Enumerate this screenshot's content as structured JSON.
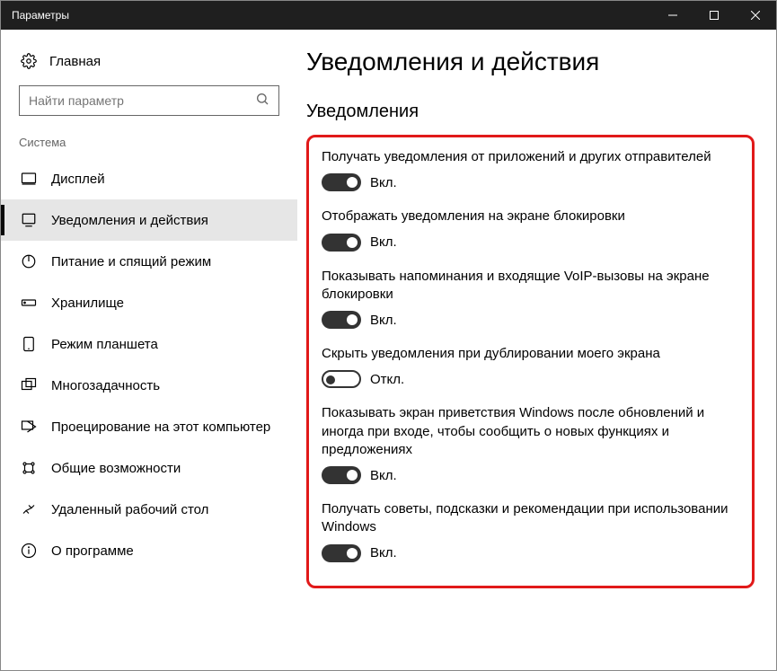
{
  "window": {
    "title": "Параметры"
  },
  "sidebar": {
    "home": "Главная",
    "search_placeholder": "Найти параметр",
    "section": "Система",
    "items": [
      {
        "label": "Дисплей"
      },
      {
        "label": "Уведомления и действия"
      },
      {
        "label": "Питание и спящий режим"
      },
      {
        "label": "Хранилище"
      },
      {
        "label": "Режим планшета"
      },
      {
        "label": "Многозадачность"
      },
      {
        "label": "Проецирование на этот компьютер"
      },
      {
        "label": "Общие возможности"
      },
      {
        "label": "Удаленный рабочий стол"
      },
      {
        "label": "О программе"
      }
    ]
  },
  "content": {
    "title": "Уведомления и действия",
    "subhead": "Уведомления",
    "on_text": "Вкл.",
    "off_text": "Откл.",
    "settings": [
      {
        "label": "Получать уведомления от приложений и других отправителей",
        "on": true
      },
      {
        "label": "Отображать уведомления на экране блокировки",
        "on": true
      },
      {
        "label": "Показывать напоминания и входящие VoIP-вызовы на экране блокировки",
        "on": true
      },
      {
        "label": "Скрыть уведомления при дублировании моего экрана",
        "on": false
      },
      {
        "label": "Показывать экран приветствия Windows после обновлений и иногда при входе, чтобы сообщить о новых функциях и предложениях",
        "on": true
      },
      {
        "label": "Получать советы, подсказки и рекомендации при использовании Windows",
        "on": true
      }
    ]
  }
}
